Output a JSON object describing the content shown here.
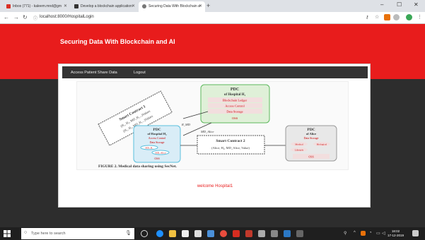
{
  "browser": {
    "tabs": [
      {
        "label": "Inbox (771) - kaleem.mnd@gm",
        "active": false
      },
      {
        "label": "Develop a blockchain application",
        "active": false
      },
      {
        "label": "Securing Data With Blockchain a",
        "active": true
      }
    ],
    "new_tab": "+",
    "url": "localhost:8000/HospitalLogin",
    "window_controls": [
      "–",
      "☐",
      "✕"
    ]
  },
  "page": {
    "title": "Securing Data With Blockchain and AI",
    "nav": [
      "Access Patient Share Data",
      "Logout"
    ],
    "welcome": "welcome Hospital1",
    "figure": {
      "pdc_top_title": "PDC",
      "pdc_top_sub": "of Hospital H₁",
      "pdc_top_rows": [
        "Blockchain Ledger",
        "Access Control",
        "Data Storage",
        "OSS"
      ],
      "smart_contract_1": "Smart Contract 1",
      "sc1_lines": [
        "(H₁, H₂, MD_H₁...)Values",
        "(H₁, H₂, MD_H₁...)Values"
      ],
      "pdc_left_title": "PDC",
      "pdc_left_sub": "of Hospital H₂",
      "pdc_left_rows": [
        "Access Control",
        "Data Storage",
        "MD_H₂",
        "MD_Alice",
        "OSS"
      ],
      "smart_contract_2": "Smart Contract 2",
      "sc2_line": "(Alice, H₂, MD_Alice, Value)",
      "pdc_right_title": "PDC",
      "pdc_right_sub": "of Alice",
      "pdc_right_rows": [
        "Data Storage",
        "Medical",
        "Biological",
        "Lifestyle",
        "OSS"
      ],
      "arrow_labels": [
        "R_MD",
        "MD_Alice"
      ],
      "caption": "FIGURE 2.   Medical data sharing using SecNet."
    }
  },
  "taskbar": {
    "search_placeholder": "Type here to search",
    "time": "18:02",
    "date": "17-12-2019"
  }
}
